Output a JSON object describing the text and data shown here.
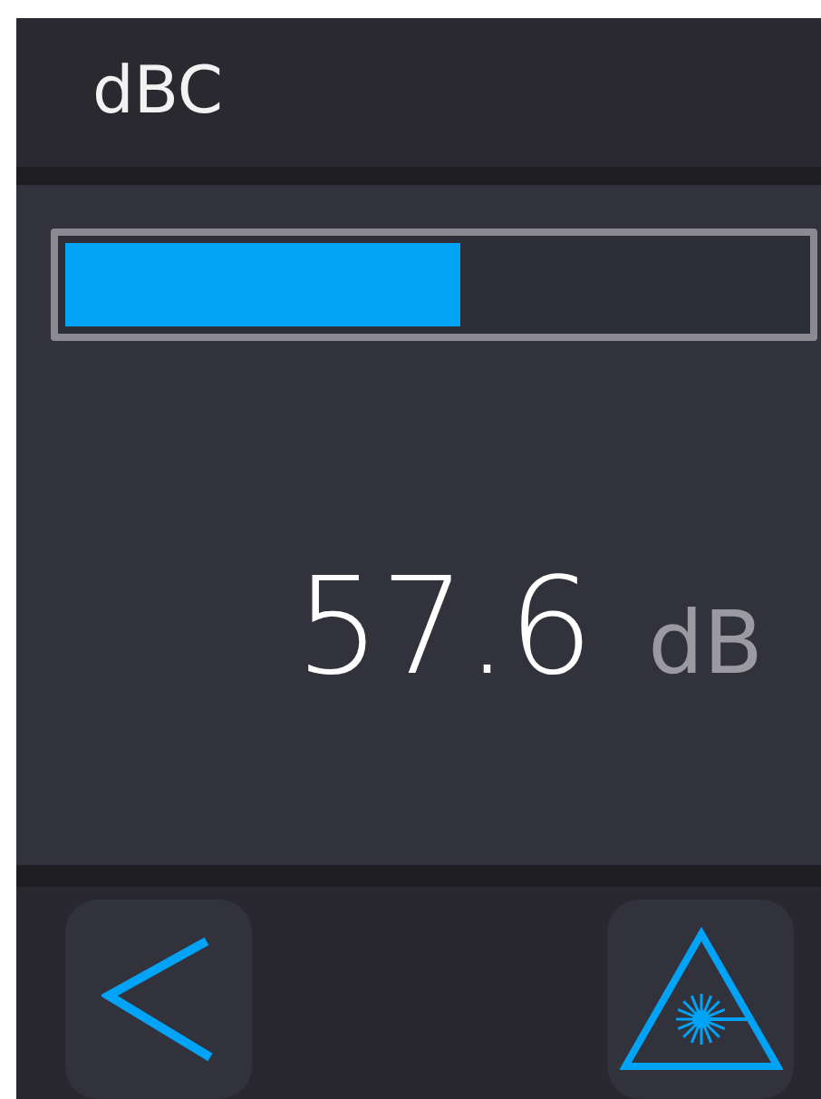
{
  "header": {
    "title": "dBC"
  },
  "meter": {
    "level": 0.535
  },
  "reading": {
    "value": "57.6",
    "unit": "dB"
  },
  "footer": {
    "buttons": [
      {
        "kind": "back"
      },
      {
        "kind": "laser"
      }
    ]
  }
}
